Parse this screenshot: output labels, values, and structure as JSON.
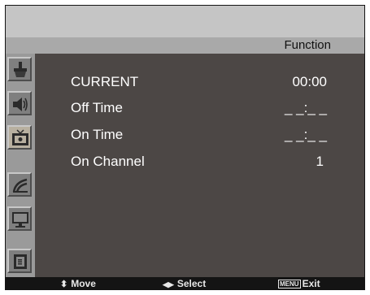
{
  "menu": {
    "title": "Function"
  },
  "sidebar": {
    "items": [
      {
        "icon": "picture-icon"
      },
      {
        "icon": "sound-icon"
      },
      {
        "icon": "tv-function-icon"
      },
      {
        "icon": "setup-icon"
      },
      {
        "icon": "screen-icon"
      },
      {
        "icon": "source-icon"
      }
    ]
  },
  "rows": [
    {
      "label": "CURRENT",
      "value": "00:00"
    },
    {
      "label": "Off Time",
      "value": "_ _:_ _"
    },
    {
      "label": "On Time",
      "value": "_ _:_ _"
    },
    {
      "label": "On Channel",
      "value": "1"
    }
  ],
  "footer": {
    "move_glyph": "⬍",
    "move_label": "Move",
    "select_glyph": "◀▶",
    "select_label": "Select",
    "menu_key": "MENU",
    "exit_label": "Exit"
  },
  "colors": {
    "panel": "#4c4745",
    "sidebar": "#9a9a9a",
    "topbar": "#c5c5c5",
    "title_strip": "#a9a9a9"
  }
}
